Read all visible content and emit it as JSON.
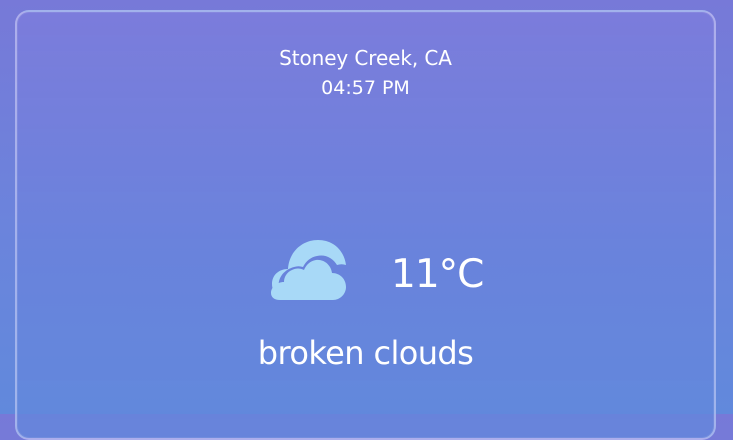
{
  "weather": {
    "location": "Stoney Creek, CA",
    "time": "04:57 PM",
    "temperature": "11°C",
    "description": "broken clouds",
    "icon": "broken-clouds-icon"
  },
  "colors": {
    "background_top": "#7779d8",
    "background_bottom": "#6189dc",
    "text": "#ffffff",
    "cloud": "#a8d9f7"
  }
}
